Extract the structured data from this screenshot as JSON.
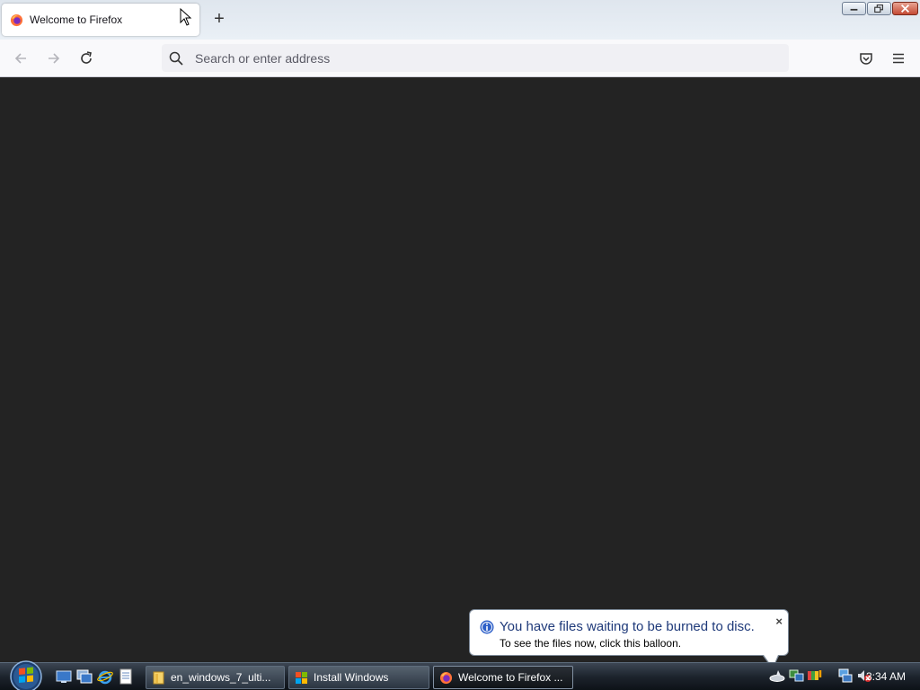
{
  "browser": {
    "tab": {
      "title": "Welcome to Firefox",
      "icon": "firefox-icon"
    },
    "new_tab_label": "+",
    "window_controls": [
      "minimize-icon",
      "restore-icon",
      "close-icon"
    ],
    "nav": {
      "back_icon": "back-arrow-icon",
      "forward_icon": "forward-arrow-icon",
      "reload_icon": "reload-icon",
      "address_placeholder": "Search or enter address",
      "address_value": "",
      "pocket_icon": "pocket-icon",
      "menu_icon": "hamburger-menu-icon"
    },
    "content_background": "#232323"
  },
  "balloon": {
    "title": "You have files waiting to be burned to disc.",
    "text": "To see the files now, click this balloon.",
    "close_label": "×"
  },
  "taskbar": {
    "start_icon": "windows-start-orb-icon",
    "quick_launch": [
      "show-desktop-icon",
      "switch-windows-icon",
      "internet-explorer-icon",
      "notepad-icon"
    ],
    "tasks": [
      {
        "label": "en_windows_7_ulti...",
        "icon": "folder-icon",
        "active": false
      },
      {
        "label": "Install Windows",
        "icon": "windows-setup-icon",
        "active": false
      },
      {
        "label": "Welcome to Firefox ...",
        "icon": "firefox-icon",
        "active": true
      }
    ],
    "tray_icons": [
      "burn-disc-icon",
      "network-icon",
      "security-alert-icon",
      "network-connection-icon",
      "volume-muted-icon"
    ],
    "clock": "3:34 AM"
  },
  "colors": {
    "accent_title": "#1f3a7a",
    "content": "#232323",
    "taskbar": "#1c232c"
  }
}
